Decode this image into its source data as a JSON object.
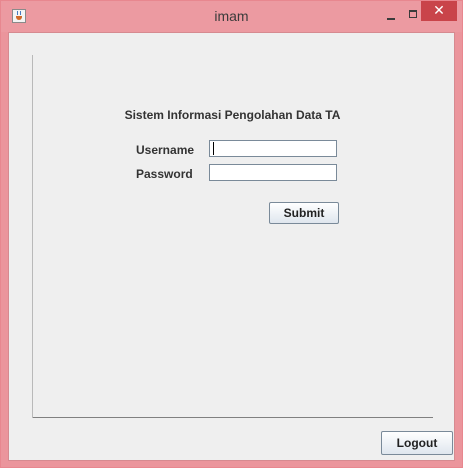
{
  "window": {
    "title": "imam",
    "close_glyph": "✕"
  },
  "form": {
    "heading": "Sistem Informasi Pengolahan Data TA",
    "username_label": "Username",
    "username_value": "",
    "password_label": "Password",
    "password_value": "",
    "submit_label": "Submit"
  },
  "footer": {
    "logout_label": "Logout"
  },
  "icons": {
    "app": "java-app-icon",
    "minimize": "minimize-icon",
    "maximize": "maximize-icon",
    "close": "close-icon"
  },
  "colors": {
    "titlebar": "#ec9aa1",
    "close_button": "#c9444a",
    "client_bg": "#efefef"
  }
}
